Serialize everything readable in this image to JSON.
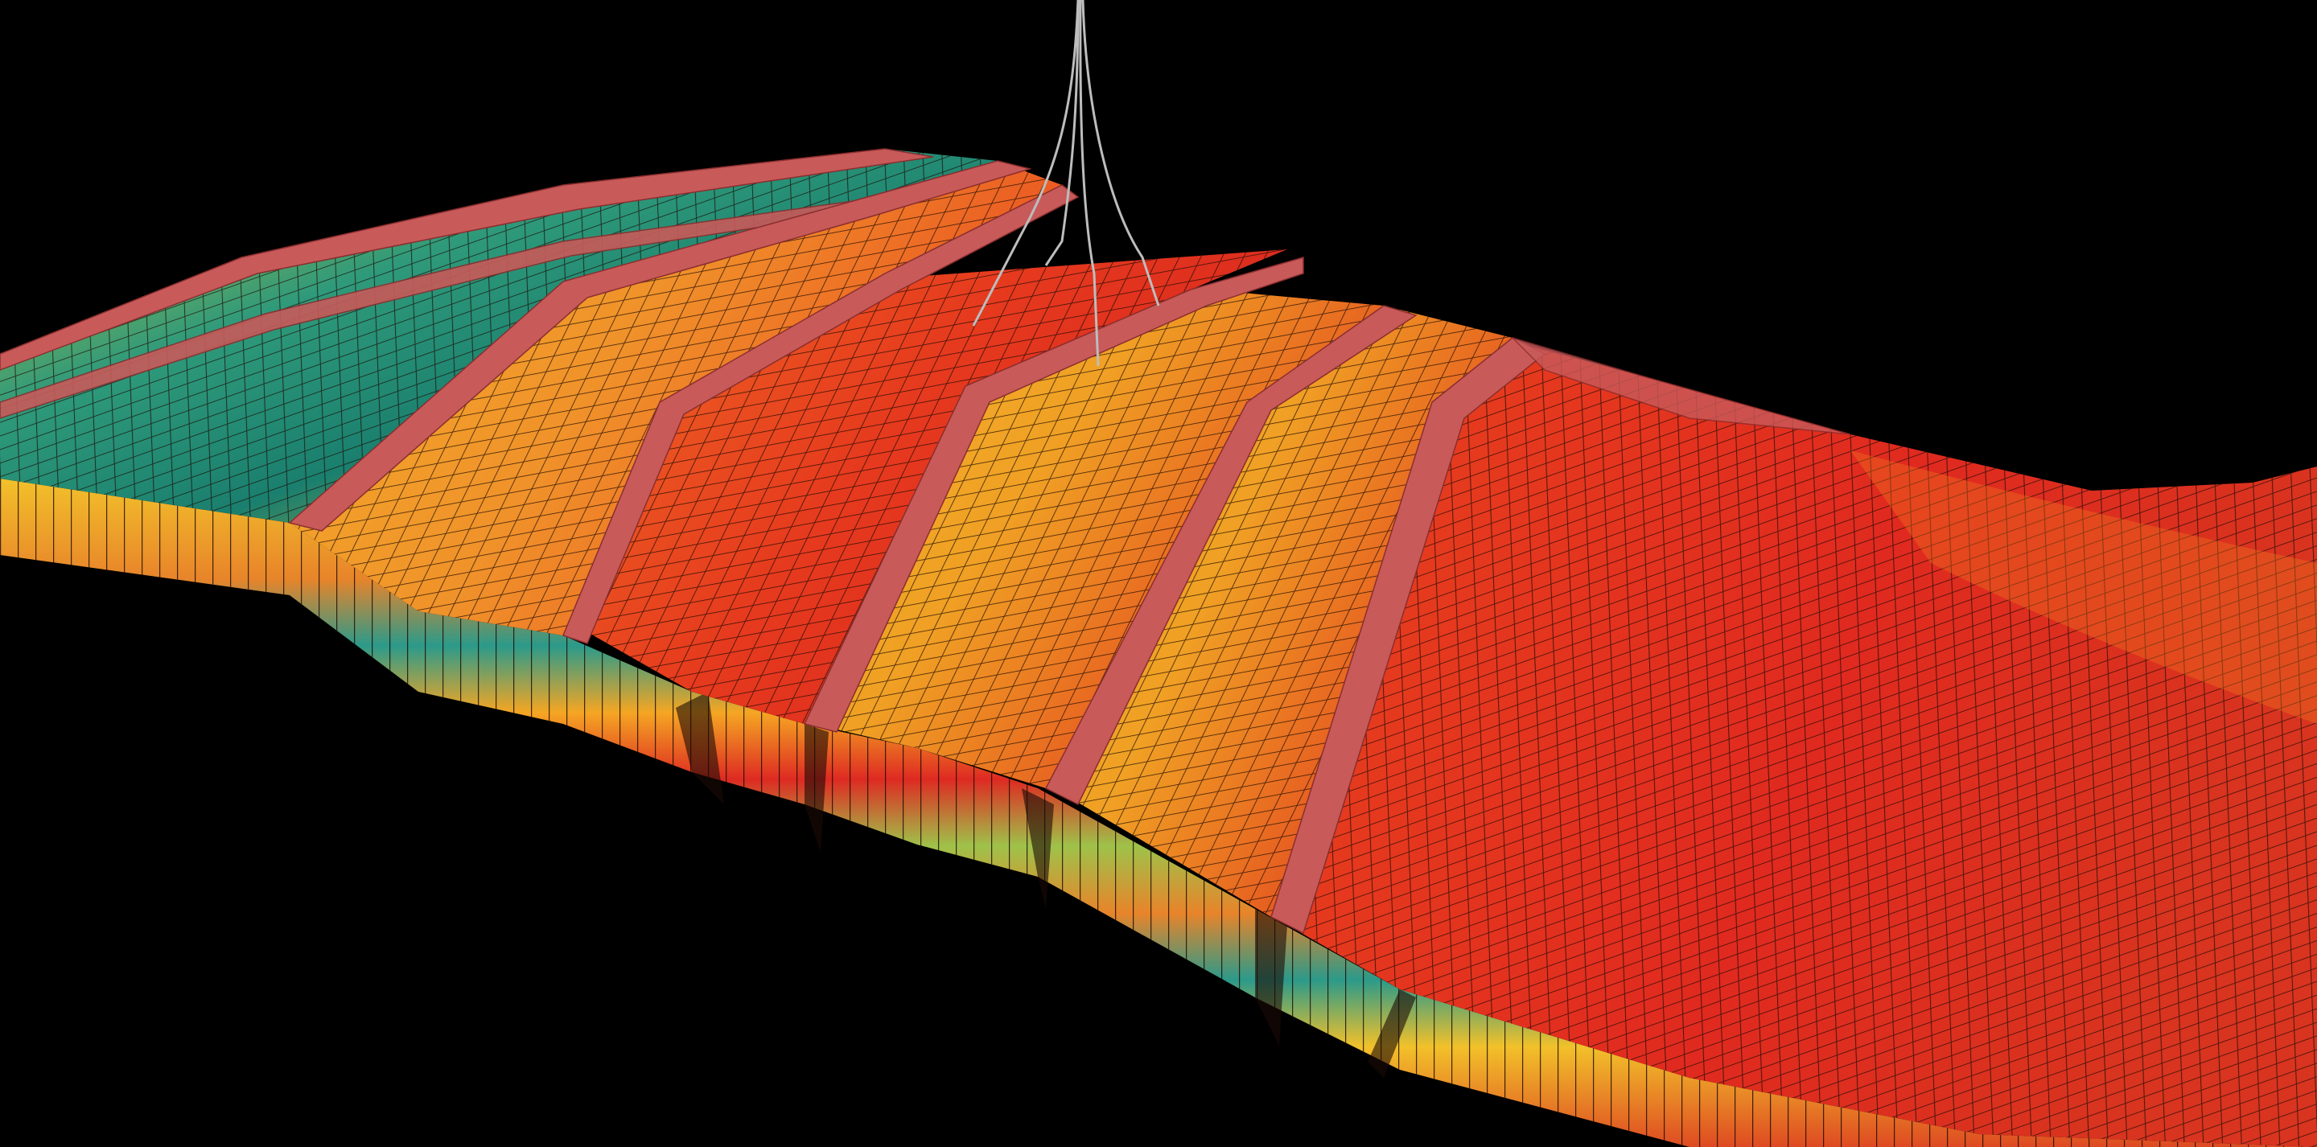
{
  "palette": {
    "background": "#000000",
    "fault_face": "#c85a5a",
    "mesh_line": "#1a0a05",
    "well_path": "#bdbdbd"
  },
  "property_ramp": [
    "#0e6d6a",
    "#2f9a7a",
    "#8fb84a",
    "#e0c42a",
    "#f4a81e",
    "#f07a1c",
    "#ea3a1e",
    "#d41f1f"
  ],
  "layer_ramp": [
    "#f2c12a",
    "#e8842a",
    "#de2a22",
    "#2b9a8a",
    "#9fc24a",
    "#f5a623"
  ],
  "well_count": 4
}
